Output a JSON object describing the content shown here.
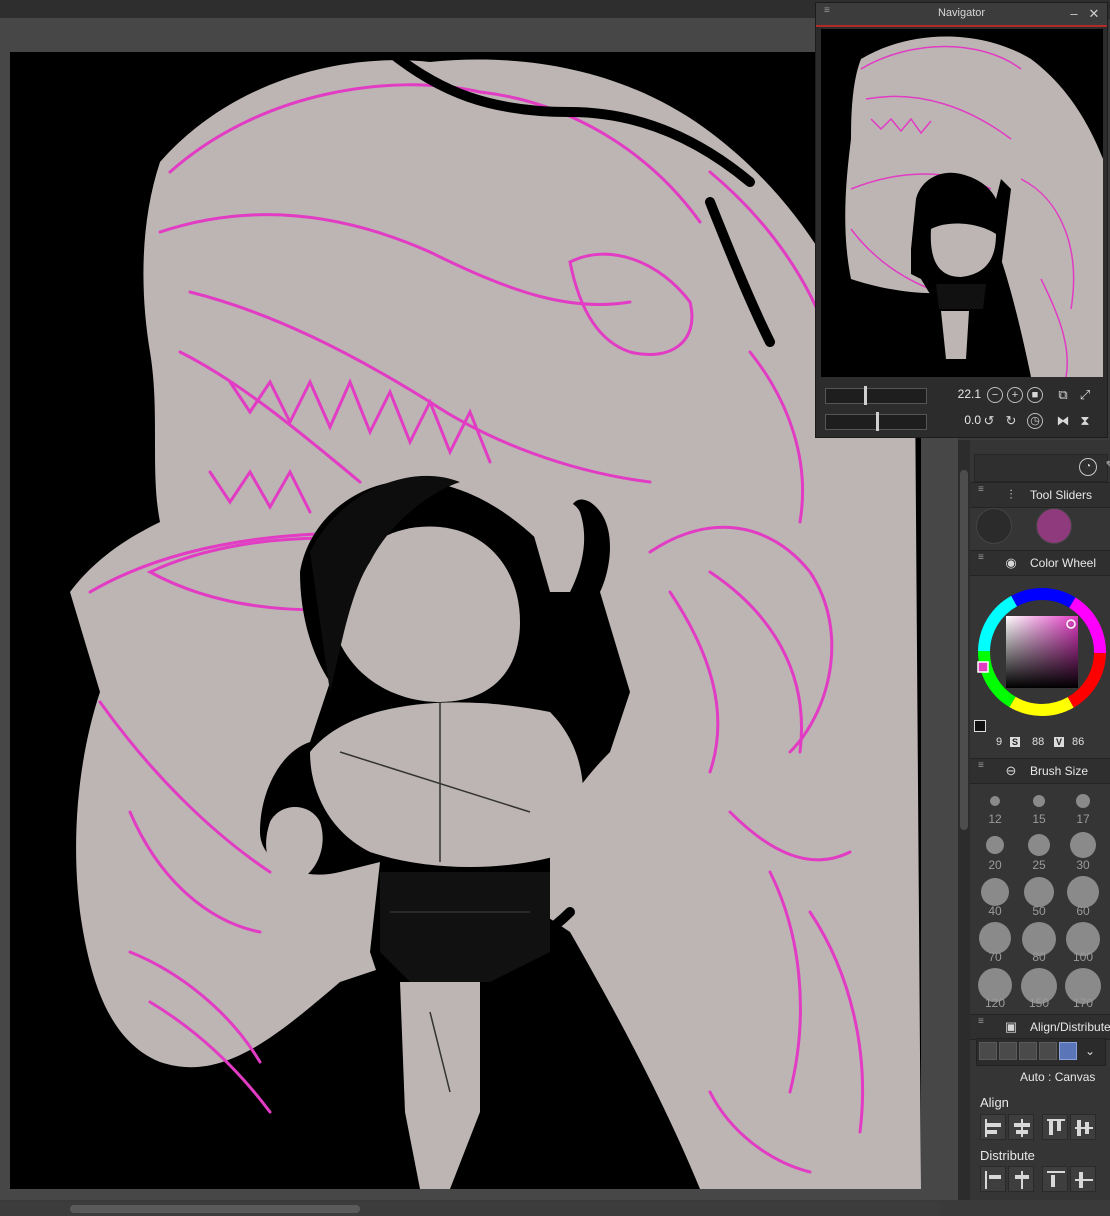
{
  "navigator": {
    "title": "Navigator",
    "zoom_value": "22.1",
    "rotation_value": "0.0"
  },
  "panels": {
    "tool_sliders": {
      "label": "Tool Sliders"
    },
    "color_wheel": {
      "label": "Color Wheel",
      "h_value": "9",
      "s_label": "S",
      "s_value": "88",
      "v_label": "V",
      "v_value": "86",
      "main_color": "#2b2b2b",
      "sub_color": "#8e3a7d"
    },
    "brush_size": {
      "label": "Brush Size",
      "sizes": [
        "12",
        "15",
        "17",
        "20",
        "25",
        "30",
        "40",
        "50",
        "60",
        "70",
        "80",
        "100",
        "120",
        "150",
        "170"
      ]
    },
    "align": {
      "label": "Align/Distribute",
      "mode_label": "Auto : Canvas",
      "align_label": "Align",
      "distribute_label": "Distribute"
    }
  },
  "colors": {
    "sketch_pink": "#e23bc4",
    "canvas_gray": "#bcb5b3",
    "ink": "#000000"
  },
  "icons": [
    "panel-grip-icon",
    "minimize-icon",
    "close-icon",
    "zoom-out-icon",
    "zoom-in-icon",
    "fit-icon",
    "fit-window-icon",
    "actual-size-icon",
    "rotate-left-icon",
    "rotate-right-icon",
    "reset-rotation-icon",
    "flip-horizontal-icon",
    "flip-vertical-icon",
    "tool-sliders-icon",
    "color-wheel-icon",
    "brush-size-icon",
    "align-distribute-icon",
    "chevron-down-icon"
  ]
}
